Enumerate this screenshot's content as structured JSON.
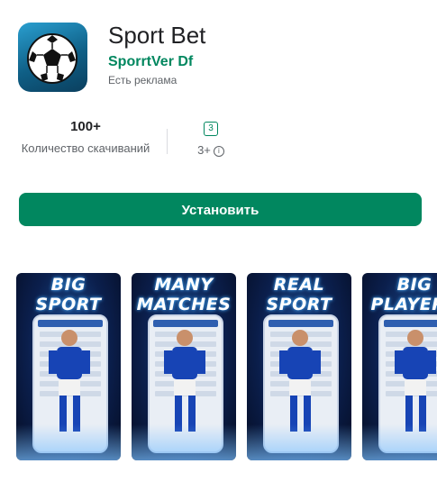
{
  "app": {
    "title": "Sport Bet",
    "developer": "SporrtVer Df",
    "ads_note": "Есть реклама",
    "icon": "soccer-ball-icon"
  },
  "stats": {
    "downloads_value": "100+",
    "downloads_label": "Количество скачиваний",
    "rating_badge": "3",
    "rating_label": "3+",
    "info_icon": "info-icon"
  },
  "install_label": "Установить",
  "screenshots": [
    {
      "line1": "BIG",
      "line2": "SPORT"
    },
    {
      "line1": "MANY",
      "line2": "MATCHES"
    },
    {
      "line1": "REAL",
      "line2": "SPORT"
    },
    {
      "line1": "BIG",
      "line2": "PLAYERS"
    }
  ],
  "colors": {
    "accent": "#01875f",
    "text": "#202124",
    "secondary": "#5f6368"
  }
}
